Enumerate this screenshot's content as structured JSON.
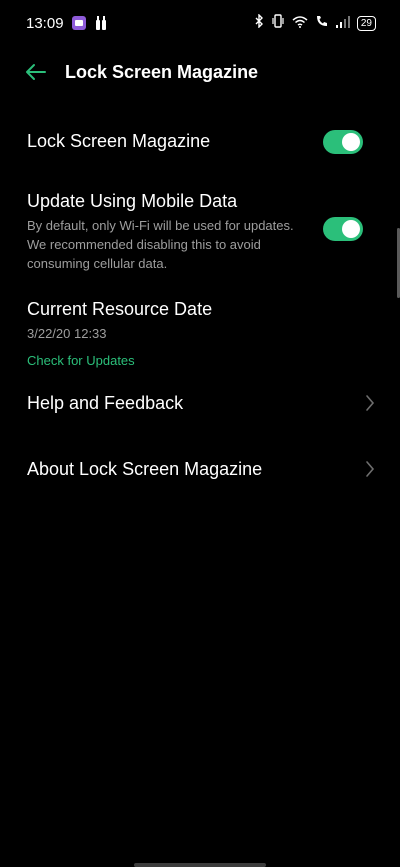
{
  "status": {
    "time": "13:09",
    "battery": "29"
  },
  "app_bar": {
    "title": "Lock Screen Magazine"
  },
  "settings": {
    "magazine": {
      "label": "Lock Screen Magazine",
      "enabled": true
    },
    "mobile_data": {
      "label": "Update Using Mobile Data",
      "description": "By default, only Wi-Fi will be used for updates. We recommended disabling this to avoid consuming cellular data.",
      "enabled": true
    },
    "resource_date": {
      "label": "Current Resource Date",
      "value": "3/22/20 12:33",
      "link": "Check for Updates"
    },
    "help": {
      "label": "Help and Feedback"
    },
    "about": {
      "label": "About Lock Screen Magazine"
    }
  },
  "colors": {
    "accent": "#2bbf7a",
    "background": "#000000",
    "secondary_text": "#9e9e9e"
  }
}
